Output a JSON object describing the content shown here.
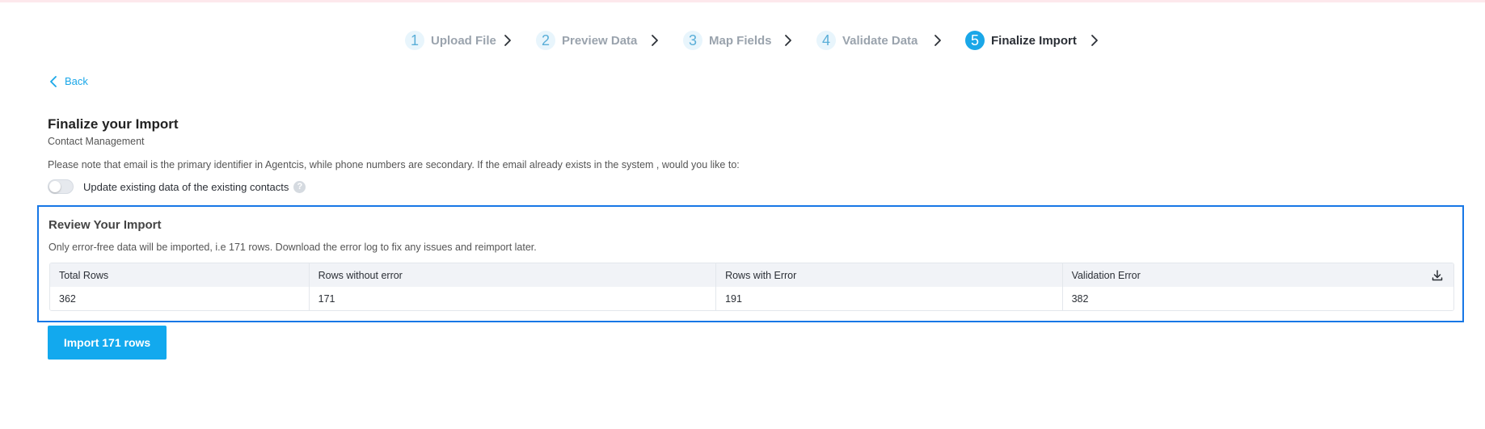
{
  "stepper": {
    "steps": [
      {
        "number": "1",
        "label": "Upload File",
        "state": "inactive"
      },
      {
        "number": "2",
        "label": "Preview Data",
        "state": "inactive"
      },
      {
        "number": "3",
        "label": "Map Fields",
        "state": "inactive"
      },
      {
        "number": "4",
        "label": "Validate Data",
        "state": "inactive"
      },
      {
        "number": "5",
        "label": "Finalize Import",
        "state": "active"
      }
    ]
  },
  "back": {
    "label": "Back",
    "icon": "chevron-left-icon"
  },
  "page": {
    "title": "Finalize your Import",
    "subtitle": "Contact Management",
    "note": "Please note that email is the primary identifier in Agentcis, while phone numbers are secondary. If the email already exists in the system , would you like to:"
  },
  "update_toggle": {
    "label": "Update existing data of the existing contacts",
    "checked": false,
    "help_icon": "?"
  },
  "review": {
    "title": "Review Your Import",
    "description": "Only error-free data will be imported, i.e 171 rows. Download the error log to fix any issues and reimport later.",
    "table": {
      "headers": [
        "Total Rows",
        "Rows without error",
        "Rows with Error",
        "Validation Error"
      ],
      "row": [
        "362",
        "171",
        "191",
        "382"
      ]
    },
    "download_icon": "download-icon"
  },
  "import_button": {
    "label": "Import 171 rows"
  },
  "colors": {
    "accent": "#1aa7e8",
    "button": "#12a9ee",
    "highlight_border": "#1777e6"
  }
}
